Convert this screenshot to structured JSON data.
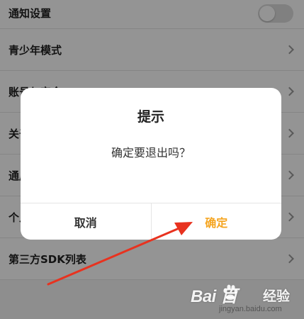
{
  "settings": {
    "items": [
      {
        "label": "通知设置",
        "control": "toggle",
        "toggle_on": false
      },
      {
        "label": "青少年模式",
        "control": "chevron"
      },
      {
        "label": "账号与安全",
        "control": "chevron"
      },
      {
        "label": "关于我们",
        "control": "chevron"
      },
      {
        "label": "通用设置",
        "control": "chevron"
      },
      {
        "label": "个人信息",
        "control": "chevron"
      },
      {
        "label": "第三方SDK列表",
        "control": "chevron"
      }
    ]
  },
  "dialog": {
    "title": "提示",
    "message": "确定要退出吗？",
    "cancel_label": "取消",
    "confirm_label": "确定"
  },
  "watermark": {
    "logo_text": "Bai 百",
    "brand": "经验",
    "url": "jingyan.baidu.com"
  },
  "colors": {
    "accent": "#f5a623",
    "annotation_arrow": "#e8321f",
    "overlay": "#000000"
  },
  "icons": {
    "chevron": "chevron-right-icon",
    "toggle": "toggle-switch"
  }
}
